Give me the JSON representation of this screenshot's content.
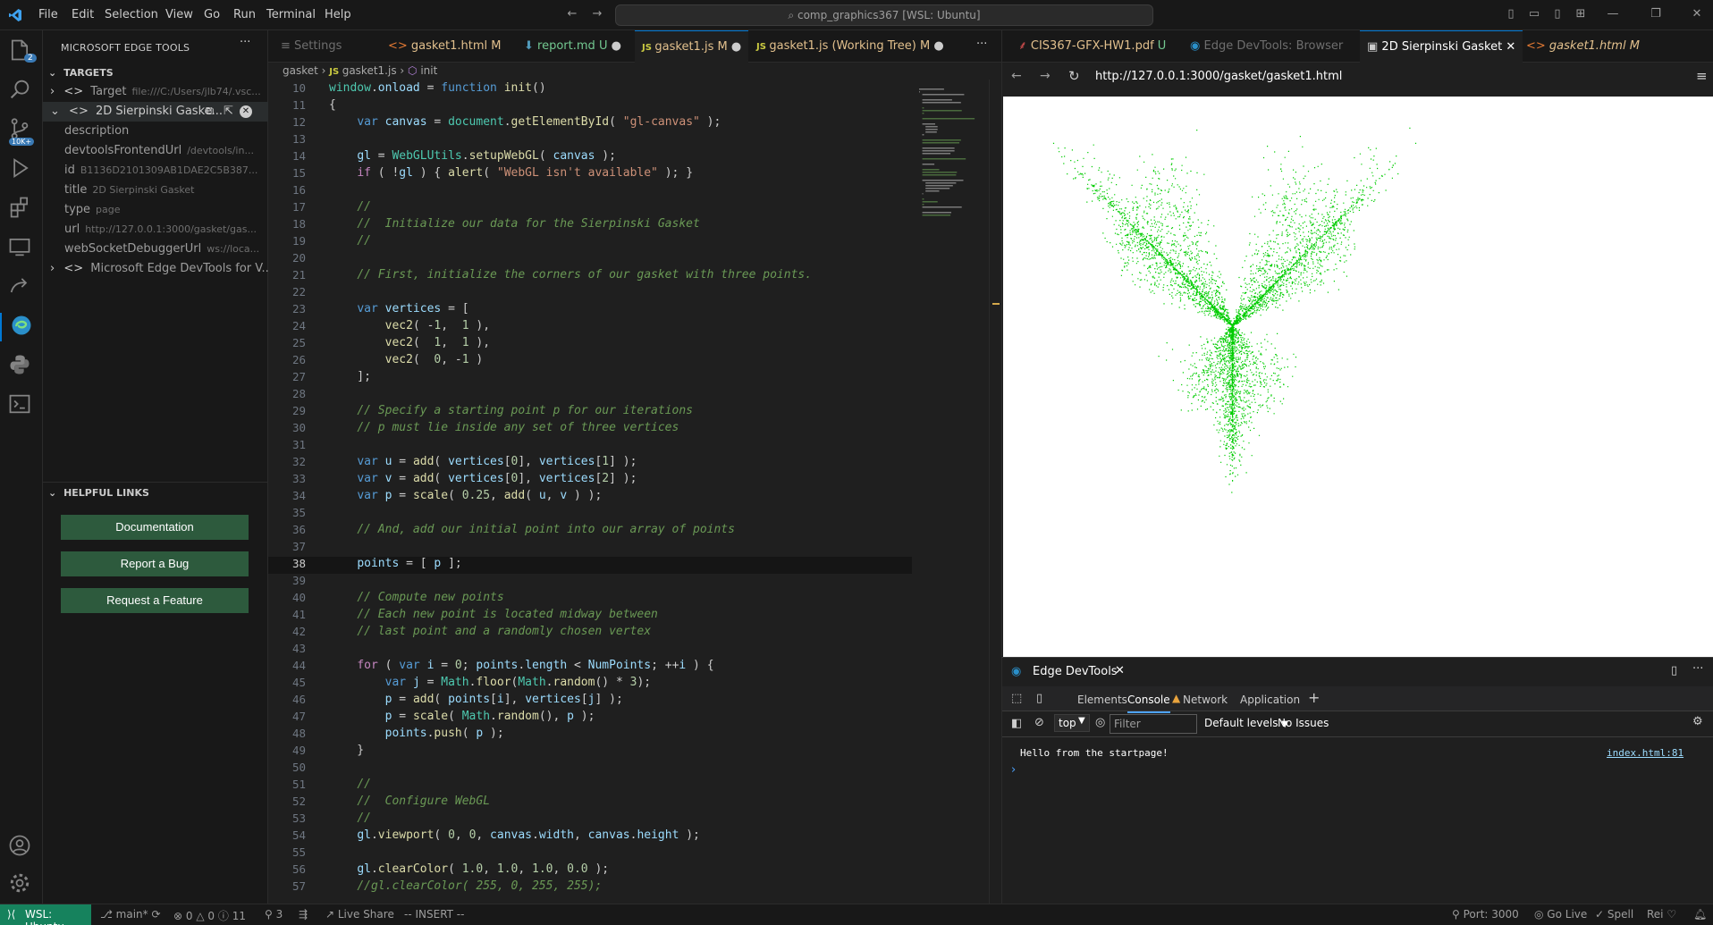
{
  "menu": [
    "File",
    "Edit",
    "Selection",
    "View",
    "Go",
    "Run",
    "Terminal",
    "Help"
  ],
  "command_center": "comp_graphics367 [WSL: Ubuntu]",
  "activity_badges": {
    "explorer": "2",
    "source_control": "10K+"
  },
  "sidebar": {
    "title": "MICROSOFT EDGE TOOLS",
    "targets_header": "TARGETS",
    "rows": [
      {
        "key": "Target",
        "val": "file:///C:/Users/jlb74/.vsc..."
      },
      {
        "key": "2D Sierpinski Gaske...",
        "val": ""
      },
      {
        "key": "description",
        "val": ""
      },
      {
        "key": "devtoolsFrontendUrl",
        "val": "/devtools/in..."
      },
      {
        "key": "id",
        "val": "B1136D2101309AB1DAE2C5B387..."
      },
      {
        "key": "title",
        "val": "2D Sierpinski Gasket"
      },
      {
        "key": "type",
        "val": "page"
      },
      {
        "key": "url",
        "val": "http://127.0.0.1:3000/gasket/gas..."
      },
      {
        "key": "webSocketDebuggerUrl",
        "val": "ws://loca..."
      },
      {
        "key": "Microsoft Edge DevTools for V...",
        "val": ""
      }
    ],
    "helpful_header": "HELPFUL LINKS",
    "buttons": [
      "Documentation",
      "Report a Bug",
      "Request a Feature"
    ]
  },
  "editor": {
    "tabs": [
      {
        "label": "Settings",
        "status": ""
      },
      {
        "label": "gasket1.html",
        "status": "M"
      },
      {
        "label": "report.md",
        "status": "U"
      },
      {
        "label": "gasket1.js",
        "status": "M"
      },
      {
        "label": "gasket1.js (Working Tree)",
        "status": "M"
      }
    ],
    "breadcrumb": [
      "gasket",
      "gasket1.js",
      "init"
    ]
  },
  "code_lines": [
    {
      "n": "10",
      "t": "window.onload = function init()"
    },
    {
      "n": "11",
      "t": "{"
    },
    {
      "n": "12",
      "t": "    var canvas = document.getElementById( \"gl-canvas\" );"
    },
    {
      "n": "13",
      "t": ""
    },
    {
      "n": "14",
      "t": "    gl = WebGLUtils.setupWebGL( canvas );"
    },
    {
      "n": "15",
      "t": "    if ( !gl ) { alert( \"WebGL isn't available\" ); }"
    },
    {
      "n": "16",
      "t": ""
    },
    {
      "n": "17",
      "t": "    //"
    },
    {
      "n": "18",
      "t": "    //  Initialize our data for the Sierpinski Gasket"
    },
    {
      "n": "19",
      "t": "    //"
    },
    {
      "n": "20",
      "t": ""
    },
    {
      "n": "21",
      "t": "    // First, initialize the corners of our gasket with three points."
    },
    {
      "n": "22",
      "t": ""
    },
    {
      "n": "23",
      "t": "    var vertices = ["
    },
    {
      "n": "24",
      "t": "        vec2( -1,  1 ),"
    },
    {
      "n": "25",
      "t": "        vec2(  1,  1 ),"
    },
    {
      "n": "26",
      "t": "        vec2(  0, -1 )"
    },
    {
      "n": "27",
      "t": "    ];"
    },
    {
      "n": "28",
      "t": ""
    },
    {
      "n": "29",
      "t": "    // Specify a starting point p for our iterations"
    },
    {
      "n": "30",
      "t": "    // p must lie inside any set of three vertices"
    },
    {
      "n": "31",
      "t": ""
    },
    {
      "n": "32",
      "t": "    var u = add( vertices[0], vertices[1] );"
    },
    {
      "n": "33",
      "t": "    var v = add( vertices[0], vertices[2] );"
    },
    {
      "n": "34",
      "t": "    var p = scale( 0.25, add( u, v ) );"
    },
    {
      "n": "35",
      "t": ""
    },
    {
      "n": "36",
      "t": "    // And, add our initial point into our array of points"
    },
    {
      "n": "37",
      "t": ""
    },
    {
      "n": "38",
      "t": "    points = [ p ];"
    },
    {
      "n": "39",
      "t": ""
    },
    {
      "n": "40",
      "t": "    // Compute new points"
    },
    {
      "n": "41",
      "t": "    // Each new point is located midway between"
    },
    {
      "n": "42",
      "t": "    // last point and a randomly chosen vertex"
    },
    {
      "n": "43",
      "t": ""
    },
    {
      "n": "44",
      "t": "    for ( var i = 0; points.length < NumPoints; ++i ) {"
    },
    {
      "n": "45",
      "t": "        var j = Math.floor(Math.random() * 3);"
    },
    {
      "n": "46",
      "t": "        p = add( points[i], vertices[j] );"
    },
    {
      "n": "47",
      "t": "        p = scale( Math.random(), p );"
    },
    {
      "n": "48",
      "t": "        points.push( p );"
    },
    {
      "n": "49",
      "t": "    }"
    },
    {
      "n": "50",
      "t": ""
    },
    {
      "n": "51",
      "t": "    //"
    },
    {
      "n": "52",
      "t": "    //  Configure WebGL"
    },
    {
      "n": "53",
      "t": "    //"
    },
    {
      "n": "54",
      "t": "    gl.viewport( 0, 0, canvas.width, canvas.height );"
    },
    {
      "n": "55",
      "t": ""
    },
    {
      "n": "56",
      "t": "    gl.clearColor( 1.0, 1.0, 1.0, 0.0 );"
    },
    {
      "n": "57",
      "t": "    //gl.clearColor( 255, 0, 255, 255);"
    }
  ],
  "browser": {
    "tabs": [
      {
        "label": "CIS367-GFX-HW1.pdf",
        "status": "U"
      },
      {
        "label": "Edge DevTools: Browser",
        "status": ""
      },
      {
        "label": "2D Sierpinski Gasket",
        "status": ""
      },
      {
        "label": "gasket1.html",
        "status": "M"
      }
    ],
    "url": "http://127.0.0.1:3000/gasket/gasket1.html",
    "point_color": "#00cc00"
  },
  "devtools": {
    "title": "Edge DevTools",
    "tabs": [
      "Elements",
      "Console",
      "Network",
      "Application"
    ],
    "context": "top",
    "filter_placeholder": "Filter",
    "levels": "Default levels",
    "issues": "No Issues",
    "console_message": "Hello from the startpage!",
    "console_source": "index.html:81"
  },
  "status": {
    "remote": "WSL: Ubuntu",
    "branch": "main*",
    "problems": "0",
    "warnings": "0",
    "info": "11",
    "ports_fwd": "3",
    "live_share": "Live Share",
    "mode": "-- INSERT --",
    "port": "Port: 3000",
    "go_live": "Go Live",
    "spell": "Spell",
    "user": "Rei"
  }
}
